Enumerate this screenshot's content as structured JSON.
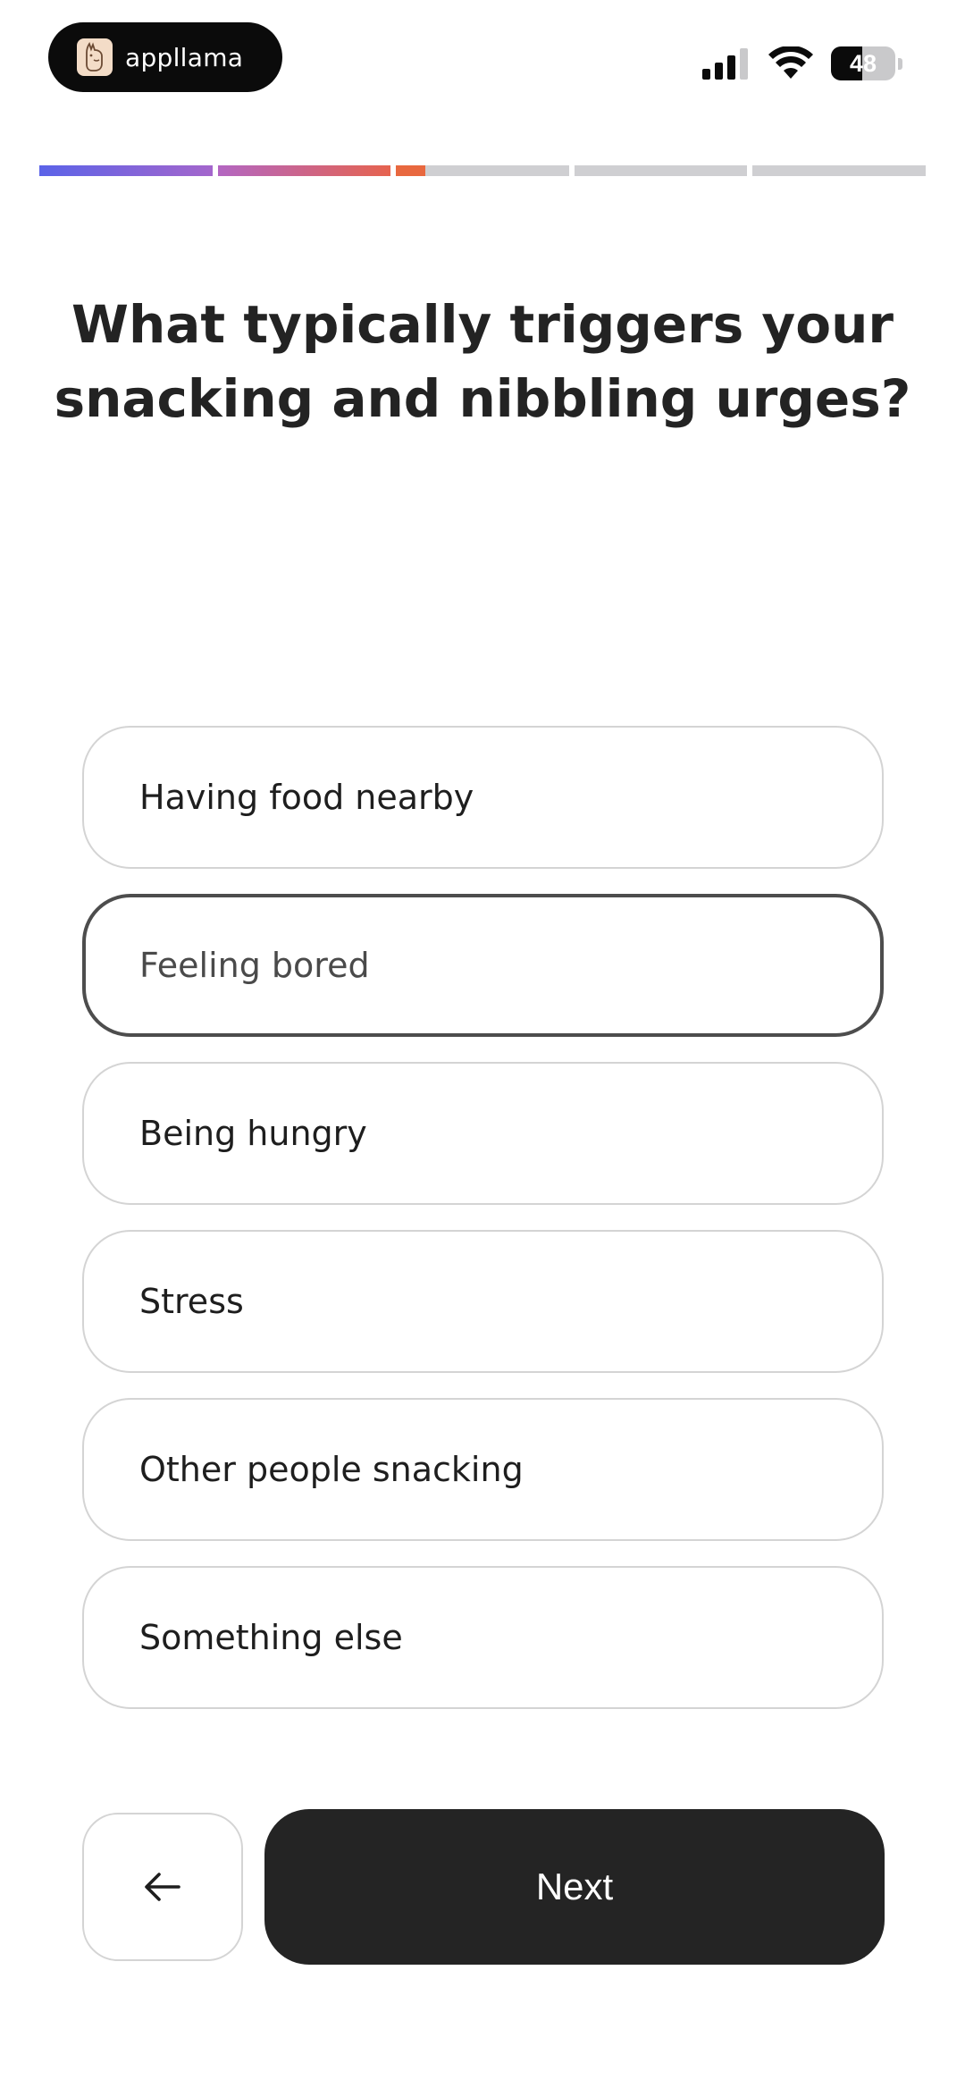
{
  "status_bar": {
    "app_name": "appllama",
    "battery_level": "48",
    "battery_fraction": 0.48,
    "icons": [
      "llama-logo-icon",
      "signal-icon",
      "wifi-icon",
      "battery-icon"
    ]
  },
  "progress": {
    "segments": [
      {
        "fill": 1.0,
        "gradient": [
          "#5b63e8",
          "#a466cc"
        ]
      },
      {
        "fill": 1.0,
        "gradient": [
          "#b366c2",
          "#e6634f"
        ]
      },
      {
        "fill": 0.17,
        "gradient": [
          "#e8683f",
          "#e8683f"
        ]
      },
      {
        "fill": 0,
        "gradient": [
          "#cfcfd2",
          "#cfcfd2"
        ]
      },
      {
        "fill": 0,
        "gradient": [
          "#cfcfd2",
          "#cfcfd2"
        ]
      }
    ]
  },
  "question": {
    "title": "What typically triggers your snacking and nibbling urges?"
  },
  "options": [
    {
      "label": "Having food nearby",
      "selected": false
    },
    {
      "label": "Feeling bored",
      "selected": true
    },
    {
      "label": "Being hungry",
      "selected": false
    },
    {
      "label": "Stress",
      "selected": false
    },
    {
      "label": "Other people snacking",
      "selected": false
    },
    {
      "label": "Something else",
      "selected": false
    }
  ],
  "navigation": {
    "back_icon": "arrow-left-icon",
    "next_label": "Next"
  },
  "colors": {
    "primary_button": "#242424",
    "selected_border": "#4d4d4d",
    "option_border": "#d4d4d4"
  }
}
